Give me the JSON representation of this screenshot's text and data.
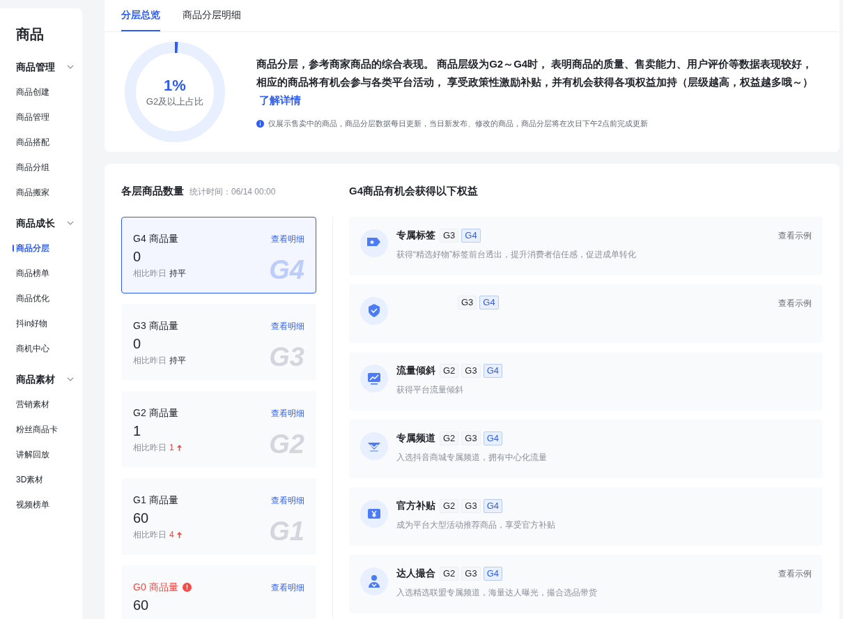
{
  "sidebar": {
    "title": "商品",
    "groups": [
      {
        "label": "商品管理",
        "expanded": true,
        "items": [
          {
            "label": "商品创建",
            "selected": false
          },
          {
            "label": "商品管理",
            "selected": false
          },
          {
            "label": "商品搭配",
            "selected": false
          },
          {
            "label": "商品分组",
            "selected": false
          },
          {
            "label": "商品搬家",
            "selected": false
          }
        ]
      },
      {
        "label": "商品成长",
        "expanded": true,
        "items": [
          {
            "label": "商品分层",
            "selected": true
          },
          {
            "label": "商品榜单",
            "selected": false
          },
          {
            "label": "商品优化",
            "selected": false
          },
          {
            "label": "抖in好物",
            "selected": false
          },
          {
            "label": "商机中心",
            "selected": false
          }
        ]
      },
      {
        "label": "商品素材",
        "expanded": true,
        "items": [
          {
            "label": "营销素材",
            "selected": false
          },
          {
            "label": "粉丝商品卡",
            "selected": false
          },
          {
            "label": "讲解回放",
            "selected": false
          },
          {
            "label": "3D素材",
            "selected": false
          },
          {
            "label": "视频榜单",
            "selected": false
          }
        ]
      }
    ]
  },
  "tabs": [
    {
      "label": "分层总览",
      "selected": true
    },
    {
      "label": "商品分层明细",
      "selected": false
    }
  ],
  "overview": {
    "donut": {
      "value": "1%",
      "caption": "G2及以上占比",
      "level": 0.01
    },
    "description": "商品分层，参考商家商品的综合表现。 商品层级为G2～G4时， 表明商品的质量、售卖能力、用户评价等数据表现较好，相应的商品将有机会参与各类平台活动， 享受政策性激励补贴，并有机会获得各项权益加持（层级越高，权益越多哦～）",
    "link": "了解详情",
    "note": "仅展示售卖中的商品，商品分层数据每日更新，当日新发布、修改的商品，商品分层将在次日下午2点前完成更新"
  },
  "tier_counts": {
    "title": "各层商品数量",
    "stat_time": "统计时间：06/14 00:00",
    "cards": [
      {
        "label": "G4 商品量",
        "value": "0",
        "compare_label": "相比昨日",
        "compare": "持平",
        "rising": false,
        "selected": true,
        "warning": false,
        "mark": "G4",
        "link": "查看明细"
      },
      {
        "label": "G3 商品量",
        "value": "0",
        "compare_label": "相比昨日",
        "compare": "持平",
        "rising": false,
        "selected": false,
        "warning": false,
        "mark": "G3",
        "link": "查看明细"
      },
      {
        "label": "G2 商品量",
        "value": "1",
        "compare_label": "相比昨日",
        "compare": "1",
        "rising": true,
        "selected": false,
        "warning": false,
        "mark": "G2",
        "link": "查看明细"
      },
      {
        "label": "G1 商品量",
        "value": "60",
        "compare_label": "相比昨日",
        "compare": "4",
        "rising": true,
        "selected": false,
        "warning": false,
        "mark": "G1",
        "link": "查看明细"
      },
      {
        "label": "G0 商品量",
        "value": "60",
        "selected": false,
        "warning": true,
        "link": "查看明细"
      }
    ]
  },
  "benefits": {
    "title": "G4商品有机会获得以下权益",
    "items": [
      {
        "kind": "tag",
        "title": "专属标签",
        "tiers": [
          {
            "label": "G3",
            "selected": false
          },
          {
            "label": "G4",
            "selected": true
          }
        ],
        "description": "获得“精选好物”标签前台透出，提升消费者信任感，促进成单转化",
        "link": "查看示例"
      },
      {
        "kind": "shield",
        "tiers": [
          {
            "label": "G3",
            "selected": false
          },
          {
            "label": "G4",
            "selected": true
          }
        ],
        "link": "查看示例"
      },
      {
        "kind": "chart",
        "title": "流量倾斜",
        "tiers": [
          {
            "label": "G2",
            "selected": false
          },
          {
            "label": "G3",
            "selected": false
          },
          {
            "label": "G4",
            "selected": true
          }
        ],
        "description": "获得平台流量倾斜"
      },
      {
        "kind": "gem",
        "title": "专属频道",
        "tiers": [
          {
            "label": "G2",
            "selected": false
          },
          {
            "label": "G3",
            "selected": false
          },
          {
            "label": "G4",
            "selected": true
          }
        ],
        "description": "入选抖音商城专属频道，拥有中心化流量"
      },
      {
        "kind": "coupon",
        "title": "官方补贴",
        "tiers": [
          {
            "label": "G2",
            "selected": false
          },
          {
            "label": "G3",
            "selected": false
          },
          {
            "label": "G4",
            "selected": true
          }
        ],
        "description": "成为平台大型活动推荐商品，享受官方补贴"
      },
      {
        "kind": "person",
        "title": "达人撮合",
        "tiers": [
          {
            "label": "G2",
            "selected": false
          },
          {
            "label": "G3",
            "selected": false
          },
          {
            "label": "G4",
            "selected": true
          }
        ],
        "description": "入选精选联盟专属频道，海量达人曝光，撮合选品带货",
        "link": "查看示例"
      }
    ]
  }
}
